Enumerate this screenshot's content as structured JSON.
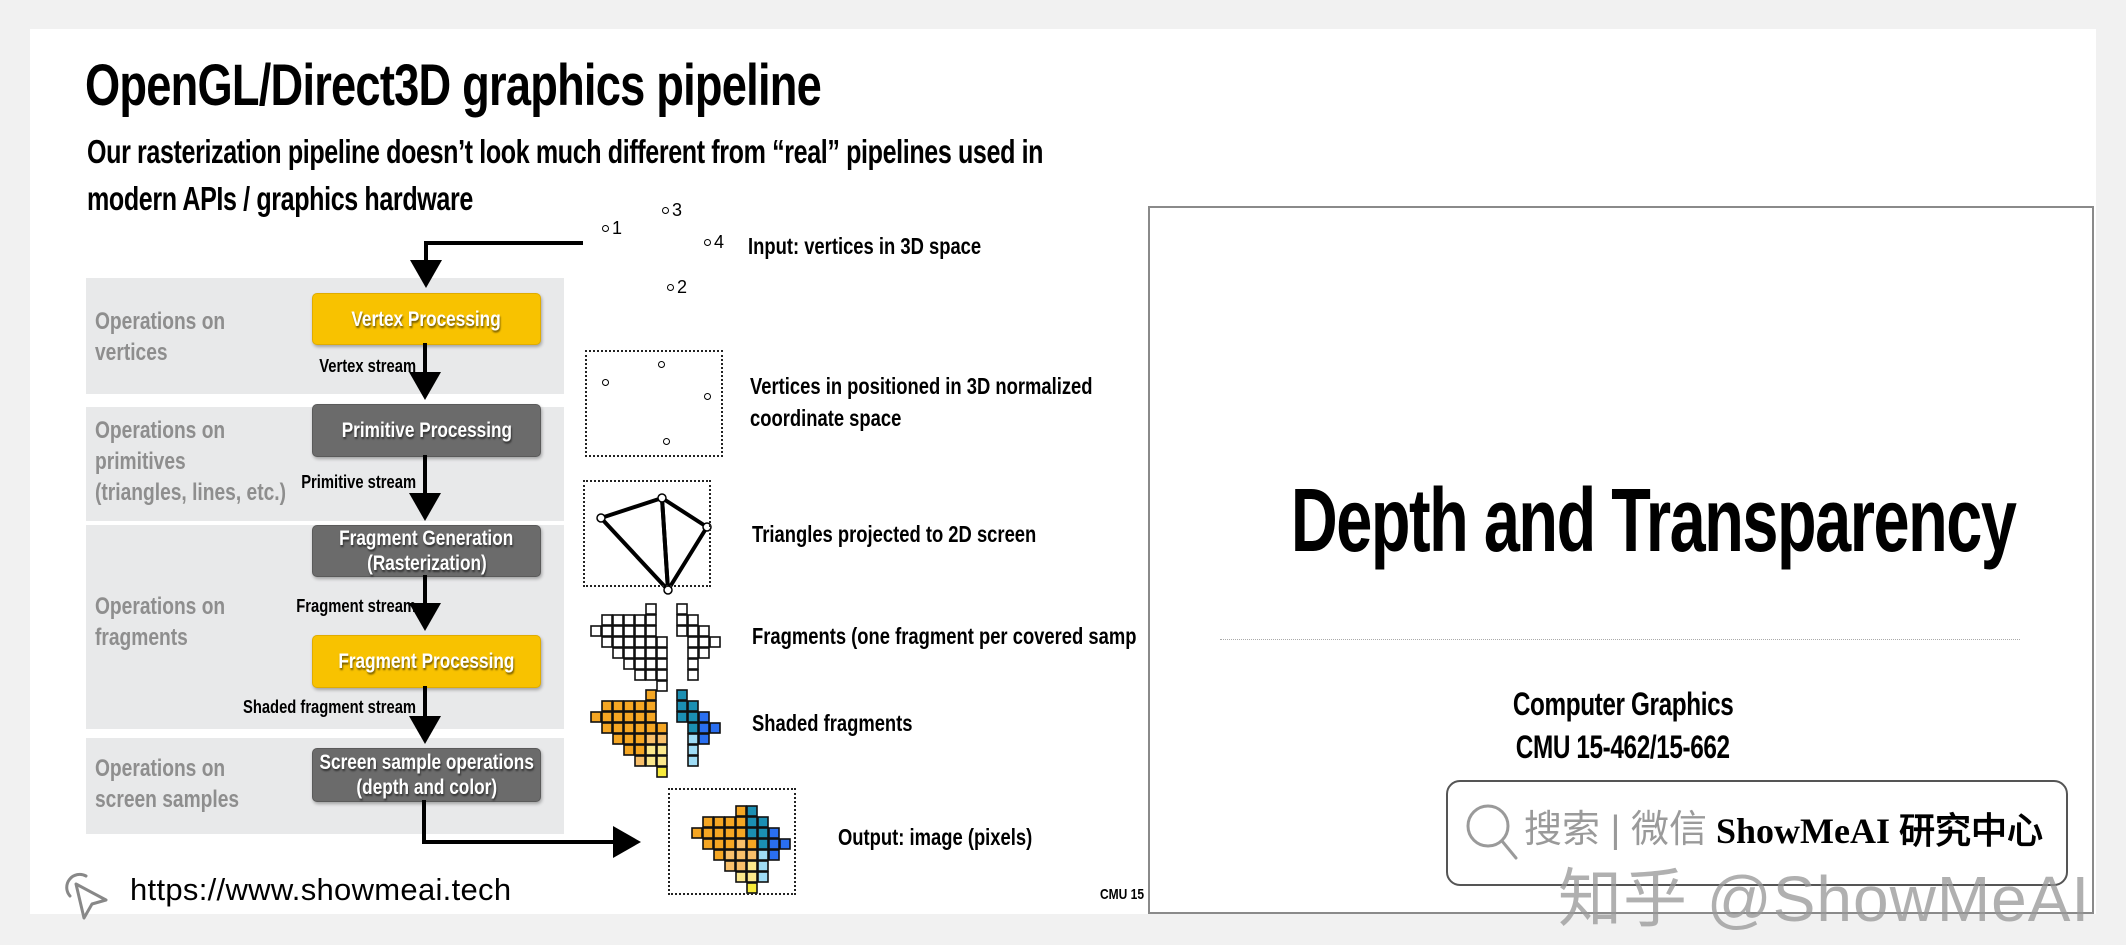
{
  "slide": {
    "title": "OpenGL/Direct3D graphics pipeline",
    "subtitle_line1": "Our rasterization pipeline doesn’t look much different from “real” pipelines used in",
    "subtitle_line2": "modern APIs / graphics hardware",
    "bands": [
      {
        "label_line1": "Operations on",
        "label_line2": "vertices",
        "label_line3": ""
      },
      {
        "label_line1": "Operations on",
        "label_line2": "primitives",
        "label_line3": "(triangles, lines, etc.)"
      },
      {
        "label_line1": "Operations on",
        "label_line2": "fragments",
        "label_line3": ""
      },
      {
        "label_line1": "Operations on",
        "label_line2": "screen samples",
        "label_line3": ""
      }
    ],
    "stages": [
      {
        "line1": "Vertex Processing",
        "line2": "",
        "color": "yellow"
      },
      {
        "line1": "Primitive Processing",
        "line2": "",
        "color": "gray"
      },
      {
        "line1": "Fragment Generation",
        "line2": "(Rasterization)",
        "color": "gray"
      },
      {
        "line1": "Fragment Processing",
        "line2": "",
        "color": "yellow"
      },
      {
        "line1": "Screen sample operations",
        "line2": "(depth and color)",
        "color": "gray"
      }
    ],
    "streams": [
      "Vertex stream",
      "Primitive stream",
      "Fragment stream",
      "Shaded fragment stream"
    ],
    "vertex_labels": [
      "1",
      "2",
      "3",
      "4"
    ],
    "descriptions": {
      "input": "Input: vertices in 3D space",
      "normalized_line1": "Vertices in positioned in 3D normalized",
      "normalized_line2": "coordinate space",
      "triangles": "Triangles projected to 2D screen",
      "fragments": "Fragments (one fragment per covered samp",
      "shaded": "Shaded fragments",
      "output": "Output: image (pixels)"
    },
    "footer_mark": "CMU 15",
    "url": "https://www.showmeai.tech"
  },
  "colors": {
    "stage_yellow": "#f8c200",
    "stage_gray": "#6b6b6b",
    "band_bg": "#e8e9ea",
    "band_label": "#8e8e8e",
    "orange": "#f5a623",
    "light_orange": "#f8bf6a",
    "pale_yellow": "#fbe88c",
    "yellow": "#f7ea3a",
    "teal": "#1b8fb3",
    "blue": "#2a6ff0",
    "light_blue": "#9fdcf5"
  },
  "right_panel": {
    "title": "Depth and Transparency",
    "course": "Computer Graphics",
    "course_code": "CMU 15-462/15-662"
  },
  "watermark": {
    "search_text": "搜索 | 微信",
    "brand_text": "ShowMeAI 研究中心",
    "overlay_text": "知乎 @ShowMeAI"
  }
}
